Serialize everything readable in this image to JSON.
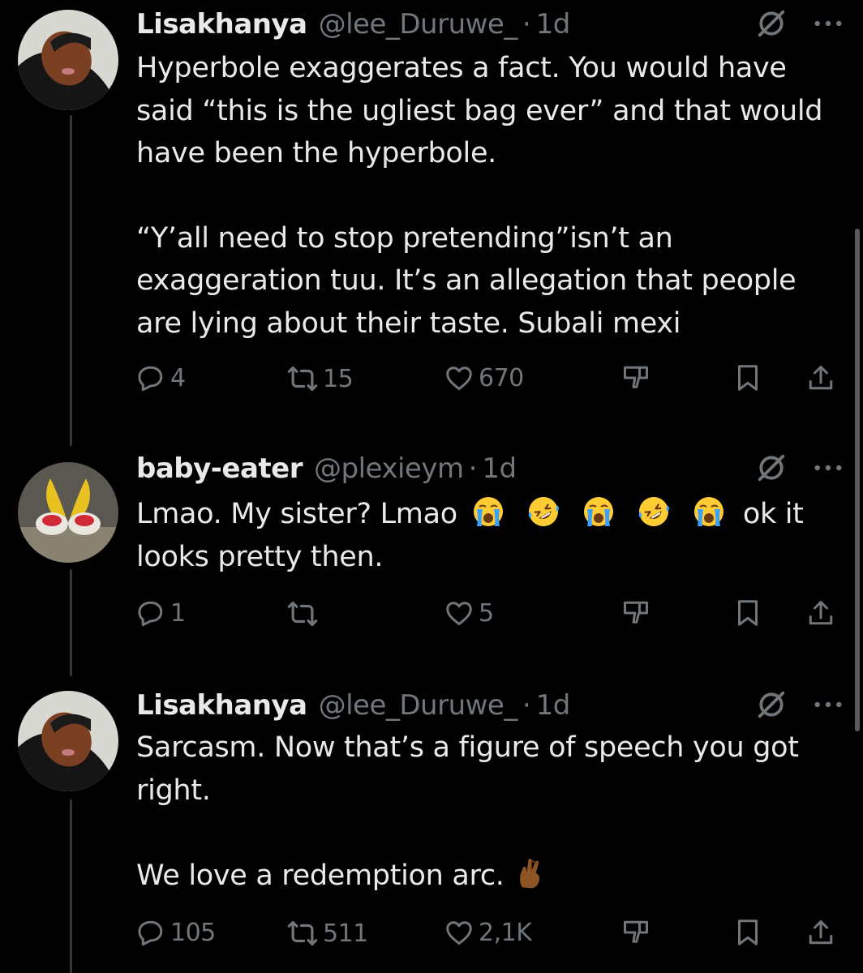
{
  "tweets": [
    {
      "name": "Lisakhanya",
      "handle": "@lee_Duruwe_",
      "separator": "·",
      "time": "1d",
      "paragraphs": [
        "Hyperbole exaggerates a fact. You would have said “this is the ugliest bag ever” and that would have been the hyperbole.",
        "“Y’all need to stop pretending”isn’t an exaggeration tuu. It’s an allegation that people are lying about their taste. Subali mexi"
      ],
      "replies": "4",
      "reposts": "15",
      "likes": "670"
    },
    {
      "name": "baby-eater",
      "handle": "@plexieym",
      "separator": "·",
      "time": "1d",
      "line1_start": "Lmao. My sister? Lmao",
      "emojis": [
        "crying-face",
        "rofl-face",
        "crying-face",
        "rofl-face",
        "crying-face"
      ],
      "line1_end": "ok it",
      "line2": "looks pretty then.",
      "replies": "1",
      "reposts": "",
      "likes": "5"
    },
    {
      "name": "Lisakhanya",
      "handle": "@lee_Duruwe_",
      "separator": "·",
      "time": "1d",
      "paragraphs": [
        "Sarcasm. Now that’s a figure of speech you got right.",
        "We love a redemption arc."
      ],
      "trailing_emoji": "crossed-fingers-dark-skin",
      "replies": "105",
      "reposts": "511",
      "likes": "2,1K"
    }
  ],
  "icons": {
    "grok": "slashed-circle-icon",
    "more": "more-horizontal-icon",
    "reply": "reply-icon",
    "repost": "repost-icon",
    "like": "heart-icon",
    "dislike": "dislike-icon",
    "bookmark": "bookmark-icon",
    "share": "share-icon"
  },
  "colors": {
    "background": "#000000",
    "text": "#e7e9ea",
    "secondary": "#71767b",
    "thread_line": "#333639"
  }
}
